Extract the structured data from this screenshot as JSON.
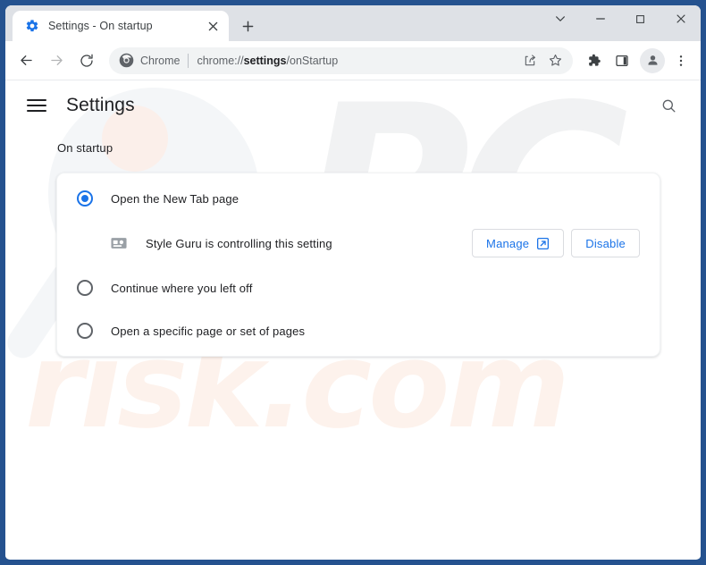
{
  "window": {
    "border_color": "#25528f",
    "caption": {
      "more_label": "v",
      "minimize_label": "Minimize",
      "maximize_label": "Maximize",
      "close_label": "Close"
    }
  },
  "tabstrip": {
    "tabs": [
      {
        "title": "Settings - On startup",
        "favicon": "settings-gear-icon",
        "active": true
      }
    ],
    "new_tab_label": "+"
  },
  "toolbar": {
    "back_icon": "arrow-back-icon",
    "forward_icon": "arrow-forward-icon",
    "reload_icon": "reload-icon",
    "omnibox": {
      "chrome_icon": "chrome-logo-icon",
      "security_label": "Chrome",
      "url_prefix": "chrome://",
      "url_bold": "settings",
      "url_suffix": "/onStartup",
      "share_icon": "share-icon",
      "bookmark_icon": "star-icon"
    },
    "extensions_icon": "puzzle-piece-icon",
    "sidepanel_icon": "side-panel-icon",
    "profile_icon": "avatar-icon",
    "menu_icon": "three-dot-menu-icon"
  },
  "settings": {
    "menu_icon": "hamburger-menu-icon",
    "title": "Settings",
    "search_icon": "search-icon",
    "section_label": "On startup",
    "options": [
      {
        "label": "Open the New Tab page",
        "checked": true
      },
      {
        "label": "Continue where you left off",
        "checked": false
      },
      {
        "label": "Open a specific page or set of pages",
        "checked": false
      }
    ],
    "extension_notice": {
      "icon": "extension-icon",
      "text": "Style Guru is controlling this setting",
      "manage_label": "Manage",
      "manage_icon": "open-in-new-icon",
      "disable_label": "Disable"
    },
    "accent_color": "#1a73e8"
  },
  "watermarks": {
    "top": "PC",
    "bottom": "risk.com"
  }
}
